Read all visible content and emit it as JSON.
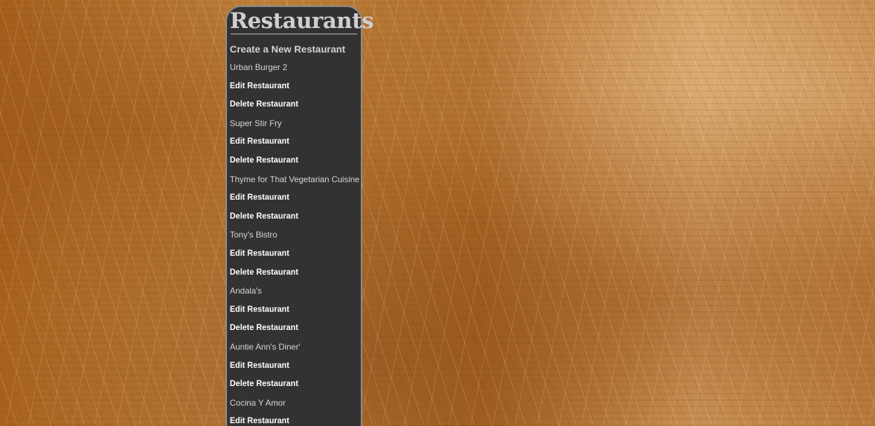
{
  "header": {
    "title": "Restaurants"
  },
  "actions": {
    "create_label": "Create a New Restaurant"
  },
  "restaurants": [
    {
      "name": "Urban Burger 2",
      "edit_label": "Edit Restaurant",
      "delete_label": "Delete Restaurant"
    },
    {
      "name": "Super Stir Fry",
      "edit_label": "Edit Restaurant",
      "delete_label": "Delete Restaurant"
    },
    {
      "name": "Thyme for That Vegetarian Cuisine",
      "edit_label": "Edit Restaurant",
      "delete_label": "Delete Restaurant"
    },
    {
      "name": "Tony's Bistro",
      "edit_label": "Edit Restaurant",
      "delete_label": "Delete Restaurant"
    },
    {
      "name": "Andala's",
      "edit_label": "Edit Restaurant",
      "delete_label": "Delete Restaurant"
    },
    {
      "name": "Auntie Ann's Diner'",
      "edit_label": "Edit Restaurant",
      "delete_label": "Delete Restaurant"
    },
    {
      "name": "Cocina Y Amor",
      "edit_label": "Edit Restaurant"
    }
  ],
  "colors": {
    "panel_background": "#323232",
    "panel_border": "#8c8c8c",
    "link_text": "#ffffff",
    "name_text": "#d6d6d6",
    "title_text": "#cfcfcf"
  }
}
